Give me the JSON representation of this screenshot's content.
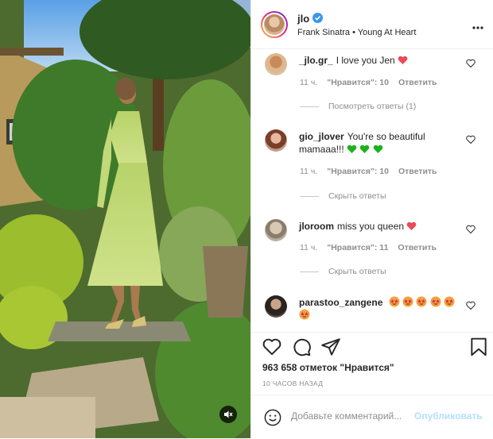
{
  "post": {
    "username": "jlo",
    "song": "Frank Sinatra • Young At Heart",
    "more_icon": "more-horizontal-icon"
  },
  "comments": [
    {
      "user": "_jlo.gr_",
      "text": "I love you Jen",
      "emoji": "red-heart",
      "time": "11 ч.",
      "likes": "\"Нравится\": 10",
      "reply": "Ответить",
      "replies": "Посмотреть ответы (1)"
    },
    {
      "user": "gio_jlover",
      "text": "You're so beautiful mamaaa!!!",
      "emoji": "green-hearts",
      "time": "11 ч.",
      "likes": "\"Нравится\": 10",
      "reply": "Ответить",
      "replies": "Скрыть ответы"
    },
    {
      "user": "jloroom",
      "text": "miss you queen",
      "emoji": "red-heart",
      "time": "11 ч.",
      "likes": "\"Нравится\": 11",
      "reply": "Ответить",
      "replies": "Скрыть ответы"
    },
    {
      "user": "parastoo_zangene",
      "text": "",
      "emoji": "star-struck-faces"
    }
  ],
  "actions": {
    "likes_count": "963 658 отметок \"Нравится\"",
    "time_ago": "10 ЧАСОВ НАЗАД"
  },
  "add_comment": {
    "placeholder": "Добавьте комментарий...",
    "publish_label": "Опубликовать"
  },
  "colors": {
    "verified": "#3897f0",
    "heart_red": "#ed4956",
    "heart_green": "#1db21d",
    "publish_disabled": "#b2dffc"
  }
}
